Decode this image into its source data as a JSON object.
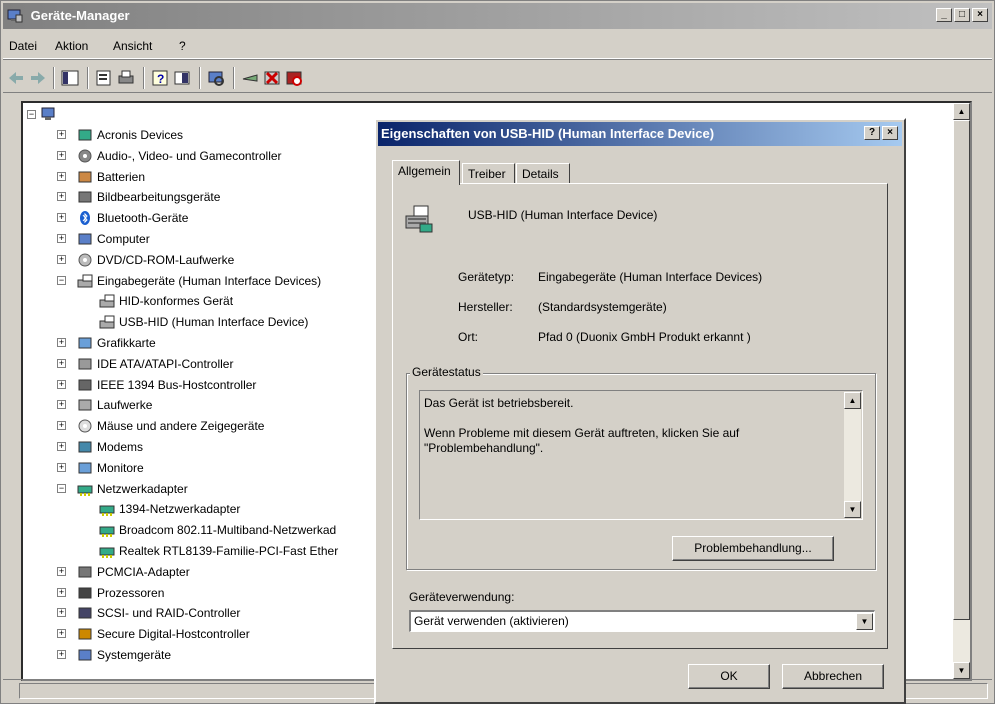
{
  "window": {
    "title": "Geräte-Manager"
  },
  "menu": [
    "Datei",
    "Aktion",
    "Ansicht",
    "?"
  ],
  "tree": [
    {
      "label": "Acronis Devices",
      "icon": "chip-icon",
      "level": 1,
      "expander": "+"
    },
    {
      "label": "Audio-, Video- und Gamecontroller",
      "icon": "speaker-icon",
      "level": 1,
      "expander": "+"
    },
    {
      "label": "Batterien",
      "icon": "battery-icon",
      "level": 1,
      "expander": "+"
    },
    {
      "label": "Bildbearbeitungsgeräte",
      "icon": "camera-icon",
      "level": 1,
      "expander": "+"
    },
    {
      "label": "Bluetooth-Geräte",
      "icon": "bluetooth-icon",
      "level": 1,
      "expander": "+"
    },
    {
      "label": "Computer",
      "icon": "computer-icon",
      "level": 1,
      "expander": "+"
    },
    {
      "label": "DVD/CD-ROM-Laufwerke",
      "icon": "cdrom-icon",
      "level": 1,
      "expander": "+"
    },
    {
      "label": "Eingabegeräte (Human Interface Devices)",
      "icon": "hid-icon",
      "level": 1,
      "expander": "-"
    },
    {
      "label": "HID-konformes Gerät",
      "icon": "hid-icon",
      "level": 2,
      "expander": ""
    },
    {
      "label": "USB-HID (Human Interface Device)",
      "icon": "hid-icon",
      "level": 2,
      "expander": ""
    },
    {
      "label": "Grafikkarte",
      "icon": "monitor-icon",
      "level": 1,
      "expander": "+"
    },
    {
      "label": "IDE ATA/ATAPI-Controller",
      "icon": "drive-icon",
      "level": 1,
      "expander": "+"
    },
    {
      "label": "IEEE 1394 Bus-Hostcontroller",
      "icon": "firewire-icon",
      "level": 1,
      "expander": "+"
    },
    {
      "label": "Laufwerke",
      "icon": "disk-icon",
      "level": 1,
      "expander": "+"
    },
    {
      "label": "Mäuse und andere Zeigegeräte",
      "icon": "mouse-icon",
      "level": 1,
      "expander": "+"
    },
    {
      "label": "Modems",
      "icon": "modem-icon",
      "level": 1,
      "expander": "+"
    },
    {
      "label": "Monitore",
      "icon": "monitor-icon",
      "level": 1,
      "expander": "+"
    },
    {
      "label": "Netzwerkadapter",
      "icon": "network-card-icon",
      "level": 1,
      "expander": "-"
    },
    {
      "label": "1394-Netzwerkadapter",
      "icon": "network-card-icon",
      "level": 2,
      "expander": ""
    },
    {
      "label": "Broadcom 802.11-Multiband-Netzwerkad",
      "icon": "network-card-icon",
      "level": 2,
      "expander": ""
    },
    {
      "label": "Realtek RTL8139-Familie-PCI-Fast Ether",
      "icon": "network-card-icon",
      "level": 2,
      "expander": ""
    },
    {
      "label": "PCMCIA-Adapter",
      "icon": "pcmcia-icon",
      "level": 1,
      "expander": "+"
    },
    {
      "label": "Prozessoren",
      "icon": "cpu-icon",
      "level": 1,
      "expander": "+"
    },
    {
      "label": "SCSI- und RAID-Controller",
      "icon": "scsi-icon",
      "level": 1,
      "expander": "+"
    },
    {
      "label": "Secure Digital-Hostcontroller",
      "icon": "sd-icon",
      "level": 1,
      "expander": "+"
    },
    {
      "label": "Systemgeräte",
      "icon": "computer-icon",
      "level": 1,
      "expander": "+"
    }
  ],
  "dialog": {
    "title": "Eigenschaften von USB-HID (Human Interface Device)",
    "help_button": "?",
    "tabs": [
      "Allgemein",
      "Treiber",
      "Details"
    ],
    "device_name": "USB-HID (Human Interface Device)",
    "device_type_label": "Gerätetyp:",
    "device_type_value": "Eingabegeräte (Human Interface Devices)",
    "manufacturer_label": "Hersteller:",
    "manufacturer_value": "(Standardsystemgeräte)",
    "location_label": "Ort:",
    "location_value": "Pfad 0 (Duonix GmbH Produkt erkannt )",
    "status_group_label": "Gerätestatus",
    "status_line1": "Das Gerät ist betriebsbereit.",
    "status_line2": "Wenn Probleme mit diesem Gerät auftreten, klicken Sie auf \"Problembehandlung\".",
    "troubleshoot_button": "Problembehandlung...",
    "usage_label": "Geräteverwendung:",
    "usage_value": "Gerät verwenden (aktivieren)",
    "ok_button": "OK",
    "cancel_button": "Abbrechen"
  }
}
